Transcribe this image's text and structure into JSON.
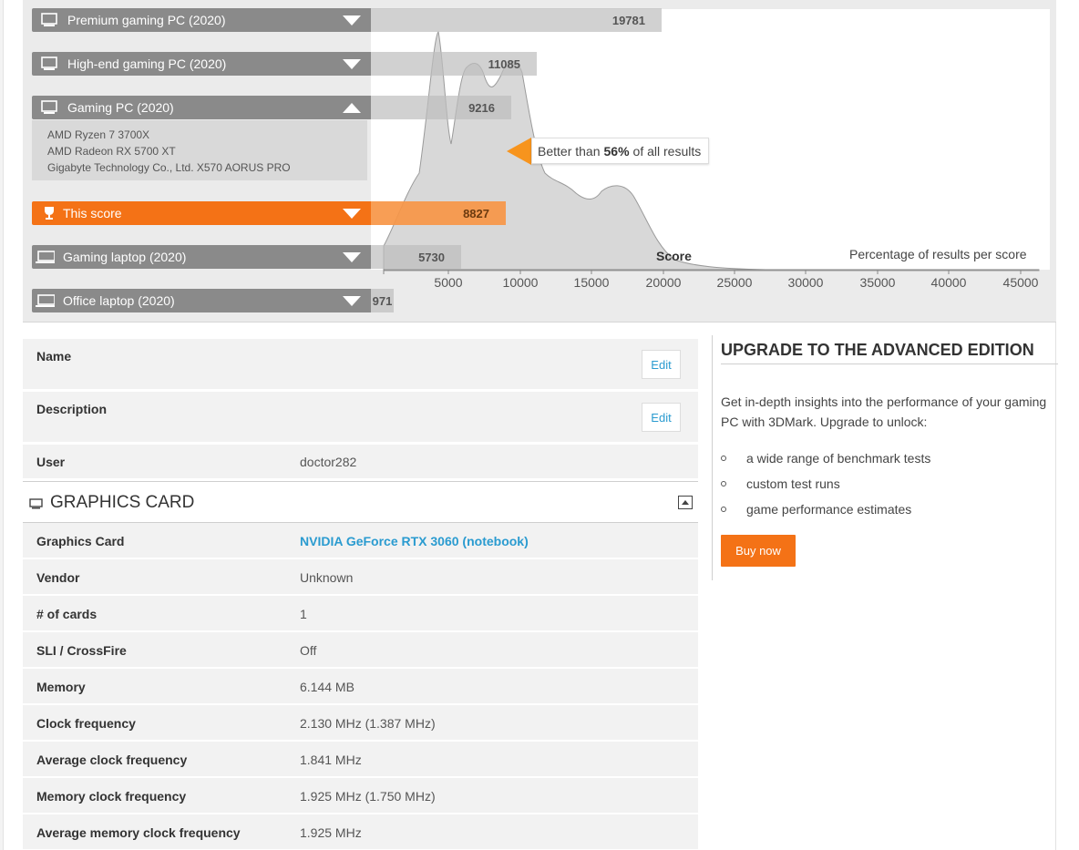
{
  "chart": {
    "axis_title": "Score",
    "right_title": "Percentage of results per score",
    "ticks": [
      "5000",
      "10000",
      "15000",
      "20000",
      "25000",
      "30000",
      "35000",
      "40000",
      "45000"
    ],
    "tooltip_prefix": "Better than",
    "tooltip_percent": "56%",
    "tooltip_suffix": "of all results"
  },
  "bars": [
    {
      "label": "Premium gaming PC (2020)",
      "score": "19781",
      "icon": "desktop-icon",
      "expanded": false
    },
    {
      "label": "High-end gaming PC (2020)",
      "score": "11085",
      "icon": "desktop-icon",
      "expanded": false
    },
    {
      "label": "Gaming PC (2020)",
      "score": "9216",
      "icon": "desktop-icon",
      "expanded": true
    },
    {
      "label": "This score",
      "score": "8827",
      "icon": "trophy-icon",
      "expanded": false
    },
    {
      "label": "Gaming laptop (2020)",
      "score": "5730",
      "icon": "laptop-icon",
      "expanded": false
    },
    {
      "label": "Office laptop (2020)",
      "score": "971",
      "icon": "laptop-icon",
      "expanded": false
    }
  ],
  "gaming_pc_details": {
    "cpu": "AMD Ryzen 7 3700X",
    "gpu": "AMD Radeon RX 5700 XT",
    "board": "Gigabyte Technology Co., Ltd. X570 AORUS PRO"
  },
  "info": {
    "name_label": "Name",
    "description_label": "Description",
    "edit_label": "Edit",
    "user_label": "User",
    "user_value": "doctor282"
  },
  "graphics_card": {
    "section_title": "GRAPHICS CARD",
    "rows": [
      {
        "key": "Graphics Card",
        "value": "NVIDIA GeForce RTX 3060 (notebook)"
      },
      {
        "key": "Vendor",
        "value": "Unknown"
      },
      {
        "key": "# of cards",
        "value": "1"
      },
      {
        "key": "SLI / CrossFire",
        "value": "Off"
      },
      {
        "key": "Memory",
        "value": "6.144 MB"
      },
      {
        "key": "Clock frequency",
        "value": "2.130 MHz (1.387 MHz)"
      },
      {
        "key": "Average clock frequency",
        "value": "1.841 MHz"
      },
      {
        "key": "Memory clock frequency",
        "value": "1.925 MHz (1.750 MHz)"
      },
      {
        "key": "Average memory clock frequency",
        "value": "1.925 MHz"
      }
    ]
  },
  "upgrade": {
    "title": "UPGRADE TO THE ADVANCED EDITION",
    "intro": "Get in-depth insights into the performance of your gaming PC with 3DMark. Upgrade to unlock:",
    "items": [
      "a wide range of benchmark tests",
      "custom test runs",
      "game performance estimates"
    ],
    "buy_label": "Buy now"
  },
  "colors": {
    "accent": "#f47216",
    "link": "#2a9bd0",
    "bar_gray": "#8a8a8a"
  }
}
